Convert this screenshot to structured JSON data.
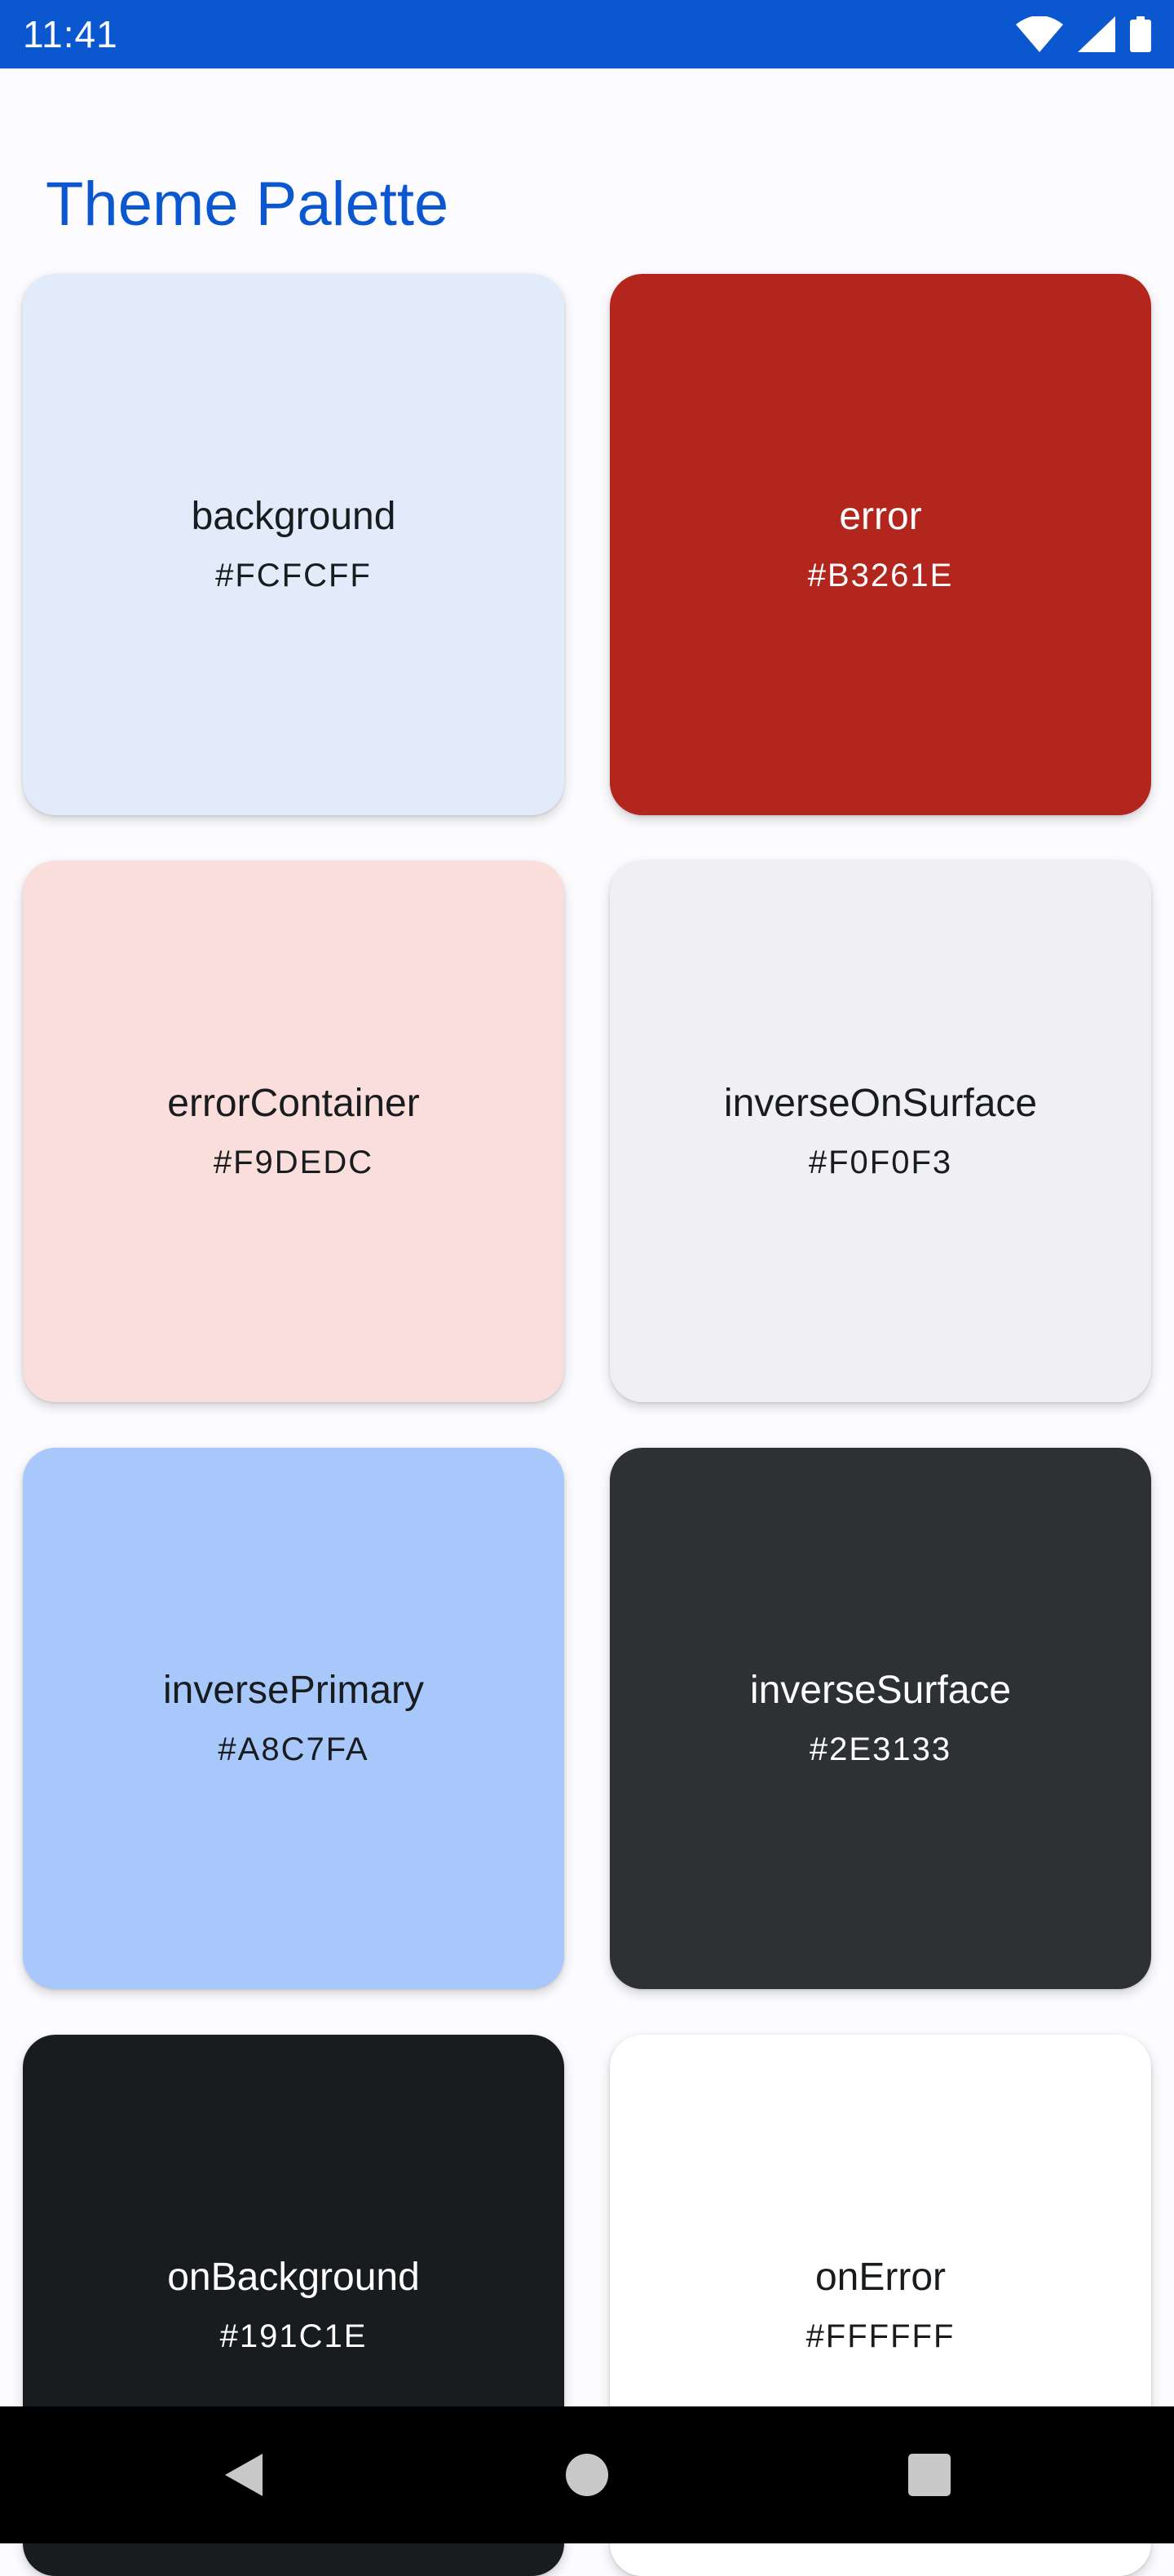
{
  "status_bar": {
    "time": "11:41",
    "icons": [
      "wifi-icon",
      "cell-signal-icon",
      "battery-icon"
    ],
    "background": "#0B57D0"
  },
  "header": {
    "title": "Theme Palette",
    "title_color": "#0B57D0"
  },
  "swatches": [
    {
      "name": "background",
      "hex": "#FCFCFF",
      "fill": "#E1EBFA",
      "text_color": "#191C1E"
    },
    {
      "name": "error",
      "hex": "#B3261E",
      "fill": "#B3261E",
      "text_color": "#FFFFFF"
    },
    {
      "name": "errorContainer",
      "hex": "#F9DEDC",
      "fill": "#F9DEDC",
      "text_color": "#191C1E"
    },
    {
      "name": "inverseOnSurface",
      "hex": "#F0F0F3",
      "fill": "#F0F0F3",
      "text_color": "#191C1E"
    },
    {
      "name": "inversePrimary",
      "hex": "#A8C7FA",
      "fill": "#A8C7FA",
      "text_color": "#191C1E"
    },
    {
      "name": "inverseSurface",
      "hex": "#2E3133",
      "fill": "#2E3133",
      "text_color": "#FFFFFF"
    },
    {
      "name": "onBackground",
      "hex": "#191C1E",
      "fill": "#191C1E",
      "text_color": "#FFFFFF"
    },
    {
      "name": "onError",
      "hex": "#FFFFFF",
      "fill": "#FFFFFF",
      "text_color": "#191C1E"
    }
  ],
  "nav_bar": {
    "buttons": [
      "back-icon",
      "home-icon",
      "recents-icon"
    ],
    "icon_color": "#C8C8C8"
  }
}
